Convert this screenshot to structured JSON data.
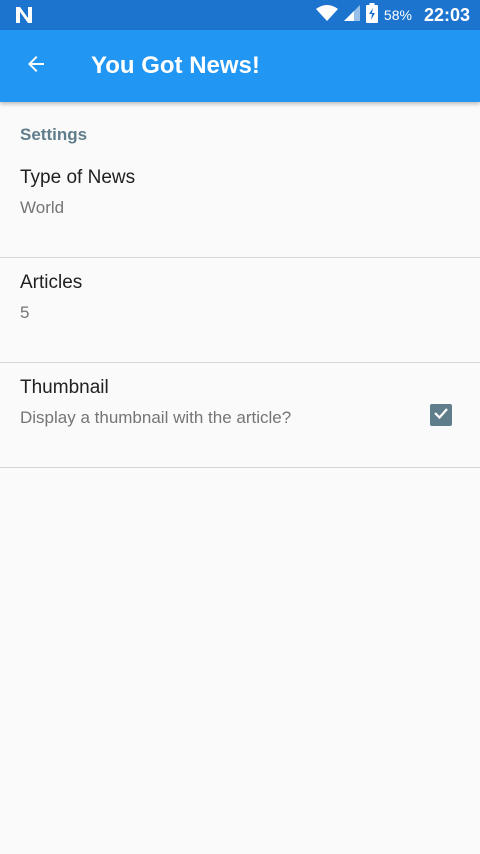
{
  "status_bar": {
    "left_icon": "n-notification-icon",
    "battery_percent": "58%",
    "time": "22:03"
  },
  "app_bar": {
    "title": "You Got News!",
    "back_icon": "arrow-left-icon"
  },
  "settings": {
    "section_header": "Settings",
    "items": [
      {
        "title": "Type of News",
        "summary": "World"
      },
      {
        "title": "Articles",
        "summary": "5"
      },
      {
        "title": "Thumbnail",
        "summary": "Display a thumbnail with the article?",
        "checked": true
      }
    ]
  },
  "colors": {
    "status_bar": "#1c74cf",
    "app_bar": "#2196f3",
    "accent": "#607d8b"
  }
}
